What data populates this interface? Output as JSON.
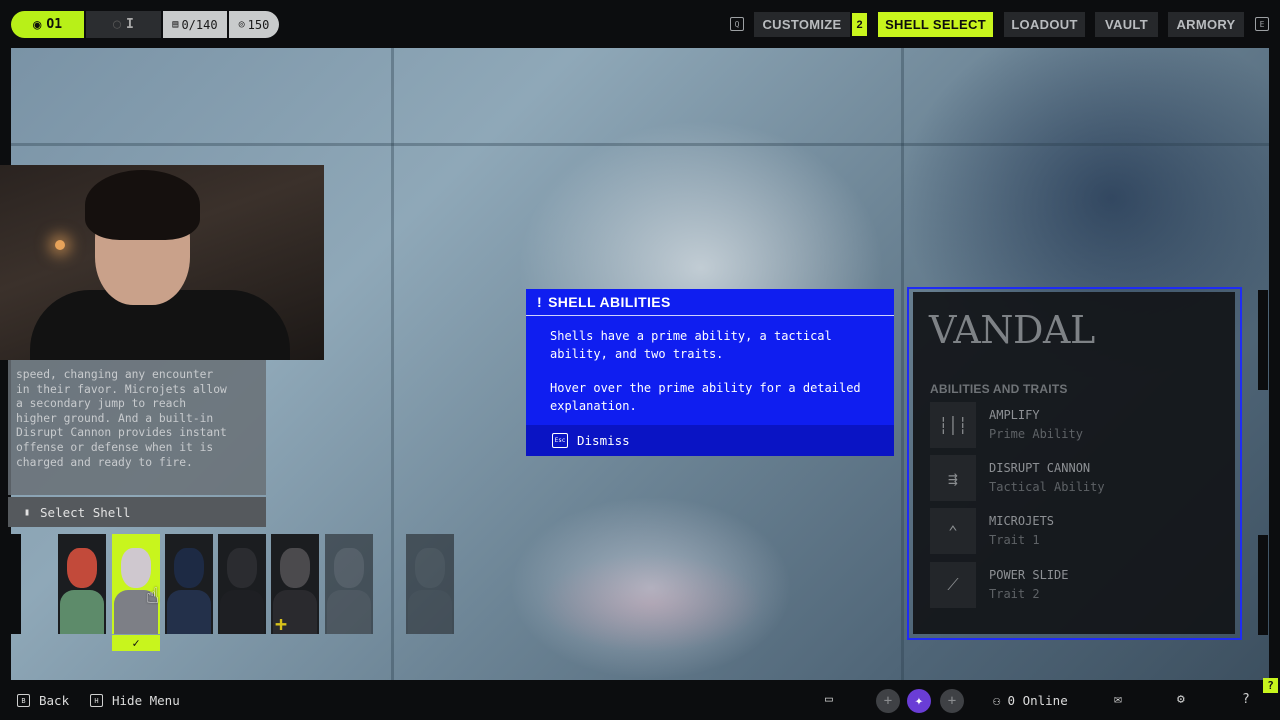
{
  "topbar": {
    "squad_label": "O1",
    "squad2_label": "I",
    "currency_value": "0/140",
    "credits_value": "150",
    "nav": {
      "customize": "CUSTOMIZE",
      "customize_badge": "2",
      "shell_select": "SHELL SELECT",
      "loadout": "LOADOUT",
      "vault": "VAULT",
      "armory": "ARMORY"
    },
    "left_key": "Q",
    "right_key": "E"
  },
  "description": {
    "text": "speed, changing any encounter\nin their favor. Microjets allow\na secondary jump to reach\nhigher ground. And a built-in\nDisrupt Cannon provides instant\noffense or defense when it is\ncharged and ready to fire.",
    "select_label": "Select Shell"
  },
  "shells": {
    "selected_index": 1,
    "check_glyph": "✓",
    "plus_glyph": "+",
    "list": [
      {
        "face": "#c24a3a",
        "body": "#5d8b6a"
      },
      {
        "face": "#cfc8cf",
        "body": "#7d7f86"
      },
      {
        "face": "#1d2a44",
        "body": "#23304a"
      },
      {
        "face": "#2b2c30",
        "body": "#1e1f23"
      },
      {
        "face": "#4b4a4d",
        "body": "#2a2a2e"
      },
      {
        "face": "#38383b",
        "body": "#2c2c2f"
      },
      {
        "face": "#2a2c2f",
        "body": "#222427"
      }
    ]
  },
  "dialog": {
    "icon": "!",
    "title": "SHELL ABILITIES",
    "paragraph1": "Shells have a prime ability, a tactical ability, and two traits.",
    "paragraph2": "Hover over the prime ability for a detailed explanation.",
    "esc_key": "Esc",
    "dismiss_label": "Dismiss",
    "bg_color": "#0f1ef0"
  },
  "vandal": {
    "name": "VANDAL",
    "subheader": "ABILITIES AND TRAITS",
    "abilities": [
      {
        "name": "AMPLIFY",
        "type": "Prime Ability",
        "icon": "soundwave-icon"
      },
      {
        "name": "DISRUPT CANNON",
        "type": "Tactical Ability",
        "icon": "cannon-icon"
      },
      {
        "name": "MICROJETS",
        "type": "Trait 1",
        "icon": "chevrons-up-icon"
      },
      {
        "name": "POWER SLIDE",
        "type": "Trait 2",
        "icon": "slide-icon"
      }
    ]
  },
  "bottombar": {
    "back_label": "Back",
    "back_key": "B",
    "hide_menu_label": "Hide Menu",
    "hide_menu_key": "H",
    "online_label": "0 Online",
    "help_glyph": "?"
  },
  "colors": {
    "accent": "#c8f51d",
    "dialog_blue": "#0f1ef0",
    "panel_border": "#1f2cf5"
  }
}
